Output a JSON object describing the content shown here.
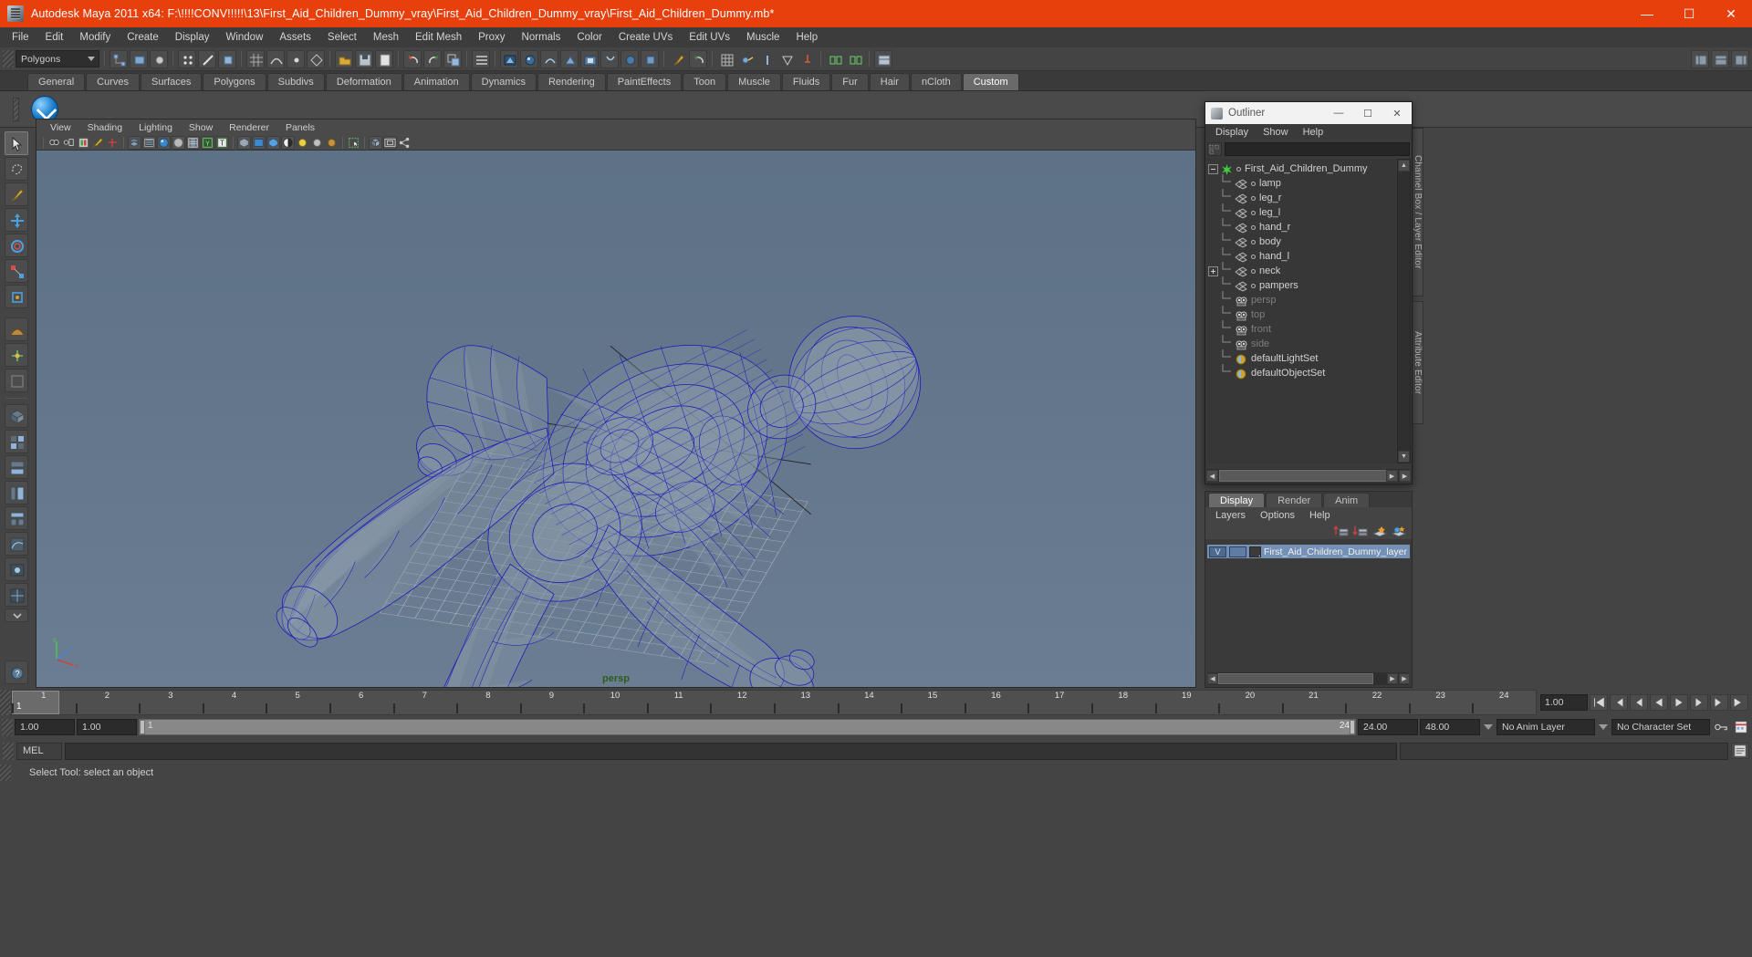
{
  "titlebar": {
    "app_title": "Autodesk Maya 2011 x64: F:\\!!!!CONV!!!!!\\13\\First_Aid_Children_Dummy_vray\\First_Aid_Children_Dummy_vray\\First_Aid_Children_Dummy.mb*",
    "minimize": "—",
    "maximize": "☐",
    "close": "✕",
    "accent_color": "#E8400C"
  },
  "menubar": {
    "items": [
      "File",
      "Edit",
      "Modify",
      "Create",
      "Display",
      "Window",
      "Assets",
      "Select",
      "Mesh",
      "Edit Mesh",
      "Proxy",
      "Normals",
      "Color",
      "Create UVs",
      "Edit UVs",
      "Muscle",
      "Help"
    ]
  },
  "statusline": {
    "mode_value": "Polygons"
  },
  "shelf": {
    "tabs": [
      "General",
      "Curves",
      "Surfaces",
      "Polygons",
      "Subdivs",
      "Deformation",
      "Animation",
      "Dynamics",
      "Rendering",
      "PaintEffects",
      "Toon",
      "Muscle",
      "Fluids",
      "Fur",
      "Hair",
      "nCloth",
      "Custom"
    ],
    "active_tab": "Custom"
  },
  "viewport": {
    "menus": [
      "View",
      "Shading",
      "Lighting",
      "Show",
      "Renderer",
      "Panels"
    ],
    "camera_label": "persp",
    "axis_labels": {
      "x": "x",
      "y": "y",
      "z": "z"
    }
  },
  "outliner": {
    "window_title": "Outliner",
    "window_buttons": {
      "minimize": "—",
      "maximize": "☐",
      "close": "✕"
    },
    "menus": [
      "Display",
      "Show",
      "Help"
    ],
    "search_value": "",
    "tree": [
      {
        "label": "First_Aid_Children_Dummy",
        "type": "group",
        "expander": "minus",
        "indent": 0,
        "dim": false
      },
      {
        "label": "lamp",
        "type": "mesh",
        "expander": "none",
        "indent": 1,
        "dim": false
      },
      {
        "label": "leg_r",
        "type": "mesh",
        "expander": "none",
        "indent": 1,
        "dim": false
      },
      {
        "label": "leg_l",
        "type": "mesh",
        "expander": "none",
        "indent": 1,
        "dim": false
      },
      {
        "label": "hand_r",
        "type": "mesh",
        "expander": "none",
        "indent": 1,
        "dim": false
      },
      {
        "label": "body",
        "type": "mesh",
        "expander": "none",
        "indent": 1,
        "dim": false
      },
      {
        "label": "hand_l",
        "type": "mesh",
        "expander": "none",
        "indent": 1,
        "dim": false
      },
      {
        "label": "neck",
        "type": "mesh",
        "expander": "plus",
        "indent": 1,
        "dim": false
      },
      {
        "label": "pampers",
        "type": "mesh",
        "expander": "none",
        "indent": 1,
        "dim": false
      },
      {
        "label": "persp",
        "type": "camera",
        "expander": "none",
        "indent": 1,
        "dim": true
      },
      {
        "label": "top",
        "type": "camera",
        "expander": "none",
        "indent": 1,
        "dim": true
      },
      {
        "label": "front",
        "type": "camera",
        "expander": "none",
        "indent": 1,
        "dim": true
      },
      {
        "label": "side",
        "type": "camera",
        "expander": "none",
        "indent": 1,
        "dim": true
      },
      {
        "label": "defaultLightSet",
        "type": "set",
        "expander": "none",
        "indent": 1,
        "dim": false
      },
      {
        "label": "defaultObjectSet",
        "type": "set",
        "expander": "none",
        "indent": 1,
        "dim": false
      }
    ]
  },
  "layer_editor": {
    "tabs": [
      "Display",
      "Render",
      "Anim"
    ],
    "active_tab": "Display",
    "menus": [
      "Layers",
      "Options",
      "Help"
    ],
    "layers": [
      {
        "visibility": "V",
        "name": "First_Aid_Children_Dummy_layer",
        "selected": true
      }
    ],
    "selected_color": "#7590b5"
  },
  "side_tabs": [
    "Channel Box / Layer Editor",
    "Attribute Editor"
  ],
  "timeslider": {
    "current_frame": "1",
    "ticks": [
      "1",
      "2",
      "3",
      "4",
      "5",
      "6",
      "7",
      "8",
      "9",
      "10",
      "11",
      "12",
      "13",
      "14",
      "15",
      "16",
      "17",
      "18",
      "19",
      "20",
      "21",
      "22",
      "23",
      "24"
    ],
    "playback_speed": "1.00"
  },
  "rangeslider": {
    "start_field": "1.00",
    "end_field": "1.00",
    "range_start": "1",
    "range_end": "24",
    "anim_start": "24.00",
    "anim_end": "48.00",
    "anim_layer": "No Anim Layer",
    "character_set": "No Character Set"
  },
  "commandline": {
    "language_label": "MEL",
    "input_value": ""
  },
  "helpline": {
    "text": "Select Tool: select an object"
  }
}
